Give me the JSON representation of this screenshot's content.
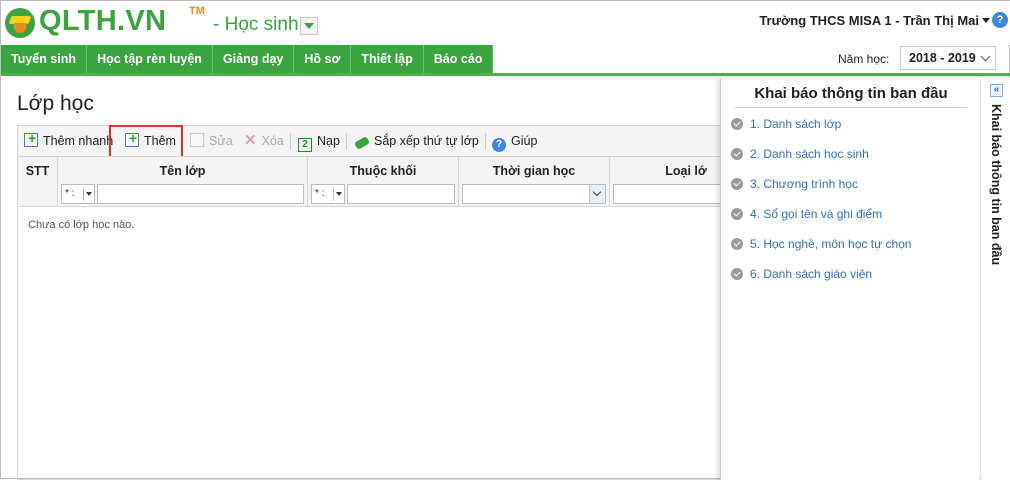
{
  "header": {
    "logo_text": "QLTH.VN",
    "logo_tm": "TM",
    "module": "- Học sinh",
    "user": "Trường THCS MISA 1 - Trần Thị Mai",
    "help_glyph": "?"
  },
  "nav": {
    "tabs": [
      "Tuyển sinh",
      "Học tập rèn luyện",
      "Giảng dạy",
      "Hồ sơ",
      "Thiết lập",
      "Báo cáo"
    ],
    "year_label": "Năm học:",
    "year_value": "2018 - 2019",
    "active_color": "#3aa53f"
  },
  "page": {
    "title": "Lớp học",
    "toolbar": {
      "quick_add": "Thêm nhanh",
      "add": "Thêm",
      "edit": "Sửa",
      "delete": "Xóa",
      "reload": "Nạp",
      "sort": "Sắp xếp thứ tự lớp",
      "help": "Giúp"
    },
    "grid": {
      "columns": [
        "STT",
        "Tên lớp",
        "Thuộc khối",
        "Thời gian học",
        "Loại lớ"
      ],
      "filter_op": "* :",
      "empty_text": "Chưa có lớp học nào."
    }
  },
  "side_panel": {
    "title": "Khai báo thông tin ban đầu",
    "vertical_title": "Khai báo thông tin ban đầu",
    "collapse_glyph": "«",
    "items": [
      "1. Danh sách lớp",
      "2. Danh sách học sinh",
      "3. Chương trình học",
      "4. Sổ gọi tên và ghi điểm",
      "5. Học nghề, môn học tự chọn",
      "6. Danh sách giáo viên"
    ]
  },
  "colors": {
    "brand_green": "#3aa53f",
    "brand_orange": "#e98b1d",
    "link_blue": "#2f6fbf",
    "highlight_red": "#d9342b"
  }
}
